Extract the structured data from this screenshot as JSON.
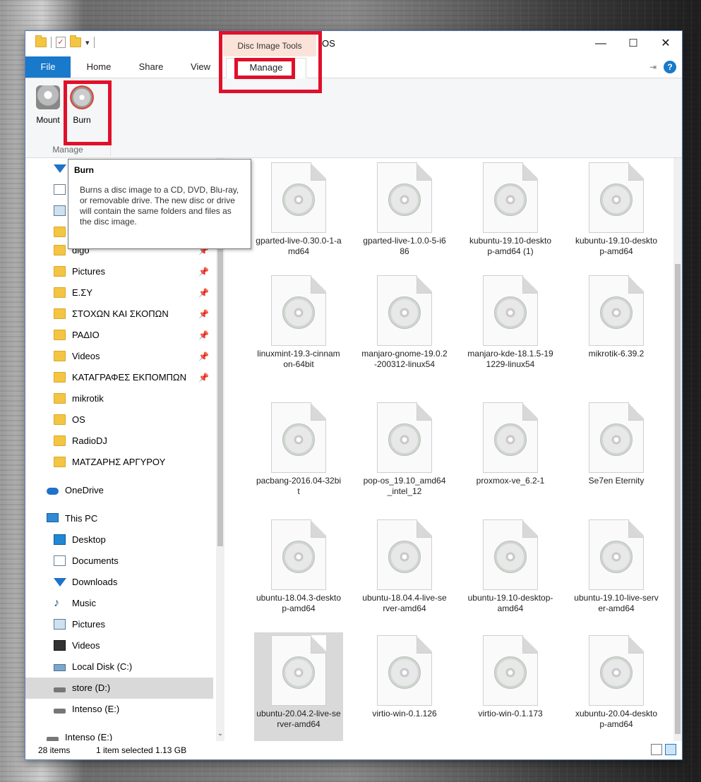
{
  "window": {
    "title": "OS",
    "contextual_group": "Disc Image Tools"
  },
  "qat": {
    "dropdown_glyph": "▾"
  },
  "controls": {
    "minimize": "—",
    "maximize": "☐",
    "close": "✕"
  },
  "tabs": {
    "file": "File",
    "home": "Home",
    "share": "Share",
    "view": "View",
    "manage": "Manage"
  },
  "ribbon": {
    "mount_label": "Mount",
    "burn_label": "Burn",
    "group_label": "Manage"
  },
  "tooltip": {
    "title": "Burn",
    "body": "Burns a disc image to a CD, DVD, Blu-ray, or removable drive. The new disc or drive will contain the same folders and files as the disc image."
  },
  "nav": {
    "pinned_glyph": "📌",
    "items": [
      {
        "label": "digo",
        "icon": "folder-icon",
        "pinned": true
      },
      {
        "label": "Pictures",
        "icon": "folder-icon",
        "pinned": true
      },
      {
        "label": "E.ΣΥ",
        "icon": "folder-icon",
        "pinned": true
      },
      {
        "label": "ΣΤΟΧΩΝ ΚΑΙ ΣΚΟΠΩΝ",
        "icon": "folder-icon",
        "pinned": true
      },
      {
        "label": "ΡΑΔΙΟ",
        "icon": "folder-icon",
        "pinned": true
      },
      {
        "label": "Videos",
        "icon": "folder-icon",
        "pinned": true
      },
      {
        "label": "ΚΑΤΑΓΡΑΦΕΣ ΕΚΠΟΜΠΩΝ",
        "icon": "folder-icon",
        "pinned": true
      },
      {
        "label": "mikrotik",
        "icon": "folder-icon",
        "pinned": false
      },
      {
        "label": "OS",
        "icon": "folder-icon",
        "pinned": false
      },
      {
        "label": "RadioDJ",
        "icon": "folder-icon",
        "pinned": false
      },
      {
        "label": "ΜΑΤΖΑΡΗΣ ΑΡΓΥΡΟΥ",
        "icon": "folder-icon",
        "pinned": false
      },
      {
        "label": "OneDrive",
        "icon": "cloud-icon"
      },
      {
        "label": "This PC",
        "icon": "computer-icon"
      },
      {
        "label": "Desktop",
        "icon": "desktop-icon"
      },
      {
        "label": "Documents",
        "icon": "documents-icon"
      },
      {
        "label": "Downloads",
        "icon": "download-icon"
      },
      {
        "label": "Music",
        "icon": "music-icon"
      },
      {
        "label": "Pictures",
        "icon": "pictures-icon"
      },
      {
        "label": "Videos",
        "icon": "video-icon"
      },
      {
        "label": "Local Disk (C:)",
        "icon": "local-disk-icon"
      },
      {
        "label": "store (D:)",
        "icon": "drive-icon",
        "selected": true
      },
      {
        "label": "Intenso (E:)",
        "icon": "drive-icon"
      },
      {
        "label": "Intenso (E:)",
        "icon": "drive-icon"
      }
    ]
  },
  "files": [
    {
      "name": "gparted-live-0.30.0-1-amd64"
    },
    {
      "name": "gparted-live-1.0.0-5-i686"
    },
    {
      "name": "kubuntu-19.10-desktop-amd64 (1)"
    },
    {
      "name": "kubuntu-19.10-desktop-amd64"
    },
    {
      "name": "linuxmint-19.3-cinnamon-64bit"
    },
    {
      "name": "manjaro-gnome-19.0.2-200312-linux54"
    },
    {
      "name": "manjaro-kde-18.1.5-191229-linux54"
    },
    {
      "name": "mikrotik-6.39.2"
    },
    {
      "name": "pacbang-2016.04-32bit"
    },
    {
      "name": "pop-os_19.10_amd64_intel_12"
    },
    {
      "name": "proxmox-ve_6.2-1"
    },
    {
      "name": "Se7en Eternity"
    },
    {
      "name": "ubuntu-18.04.3-desktop-amd64"
    },
    {
      "name": "ubuntu-18.04.4-live-server-amd64"
    },
    {
      "name": "ubuntu-19.10-desktop-amd64"
    },
    {
      "name": "ubuntu-19.10-live-server-amd64"
    },
    {
      "name": "ubuntu-20.04.2-live-server-amd64",
      "selected": true
    },
    {
      "name": "virtio-win-0.1.126"
    },
    {
      "name": "virtio-win-0.1.173"
    },
    {
      "name": "xubuntu-20.04-desktop-amd64"
    }
  ],
  "status": {
    "item_count": "28 items",
    "selection": "1 item selected  1.13 GB"
  }
}
